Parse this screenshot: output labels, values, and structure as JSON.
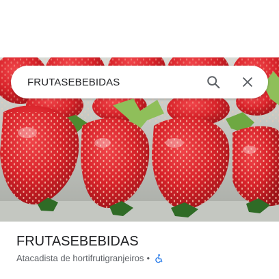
{
  "search": {
    "query": "FRUTASEBEBIDAS",
    "search_icon": "search-icon",
    "close_icon": "close-icon"
  },
  "photo": {
    "subject": "strawberries-in-plastic-container",
    "colors": {
      "berry": "#d8232a",
      "leaf": "#3f7a2a",
      "tray": "#c9ccc6"
    }
  },
  "place": {
    "name": "FRUTASEBEBIDAS",
    "category": "Atacadista de hortifrutigranjeiros",
    "separator": "•",
    "accessibility_icon": "wheelchair-accessible-icon",
    "accessibility_color": "#1a73e8"
  }
}
